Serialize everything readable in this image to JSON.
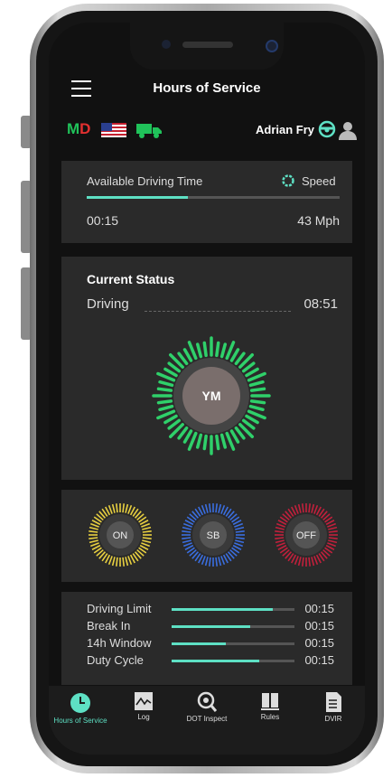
{
  "header": {
    "title": "Hours of Service",
    "menu_icon": "hamburger-menu-icon"
  },
  "subheader": {
    "md_m": "M",
    "md_d": "D",
    "flag_icon": "us-flag-icon",
    "truck_icon": "truck-icon",
    "user_name": "Adrian Fry",
    "wheel_icon": "steering-wheel-icon",
    "avatar_icon": "user-avatar-icon"
  },
  "available": {
    "label": "Available Driving Time",
    "speed_label": "Speed",
    "time": "00:15",
    "speed": "43 Mph",
    "progress": 0.4
  },
  "status": {
    "heading": "Current Status",
    "state": "Driving",
    "time": "08:51",
    "center": "YM"
  },
  "duty_buttons": [
    {
      "label": "ON",
      "color": "#e8d040"
    },
    {
      "label": "SB",
      "color": "#3a6ee0"
    },
    {
      "label": "OFF",
      "color": "#c2203c"
    }
  ],
  "limits": [
    {
      "label": "Driving Limit",
      "value": "00:15",
      "fill": 0.82
    },
    {
      "label": "Break In",
      "value": "00:15",
      "fill": 0.64
    },
    {
      "label": "14h Window",
      "value": "00:15",
      "fill": 0.44
    },
    {
      "label": "Duty Cycle",
      "value": "00:15",
      "fill": 0.71
    }
  ],
  "tabs": [
    {
      "label": "Hours of Service",
      "icon": "clock-icon"
    },
    {
      "label": "Log",
      "icon": "log-graph-icon"
    },
    {
      "label": "DOT Inspect",
      "icon": "search-gear-icon"
    },
    {
      "label": "Rules",
      "icon": "book-icon"
    },
    {
      "label": "DVIR",
      "icon": "document-icon"
    }
  ],
  "colors": {
    "accent": "#5ee0c4",
    "driving_ring": "#2fd06a"
  }
}
